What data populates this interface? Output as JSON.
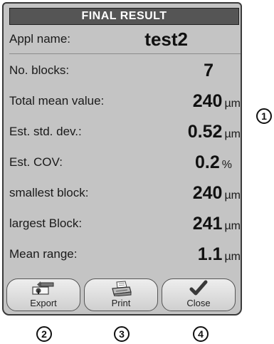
{
  "title": "FINAL RESULT",
  "appl": {
    "label": "Appl name:",
    "value": "test2"
  },
  "rows": [
    {
      "label": "No. blocks:",
      "value": "7",
      "unit": ""
    },
    {
      "label": "Total mean value:",
      "value": "240",
      "unit": "µm"
    },
    {
      "label": "Est. std. dev.:",
      "value": "0.52",
      "unit": "µm"
    },
    {
      "label": "Est. COV:",
      "value": "0.2",
      "unit": "%"
    },
    {
      "label": "smallest block:",
      "value": "240",
      "unit": "µm"
    },
    {
      "label": "largest Block:",
      "value": "241",
      "unit": "µm"
    },
    {
      "label": "Mean range:",
      "value": "1.1",
      "unit": "µm"
    }
  ],
  "buttons": {
    "export": "Export",
    "print": "Print",
    "close": "Close"
  },
  "callouts": {
    "c1": "1",
    "c2": "2",
    "c3": "3",
    "c4": "4"
  },
  "icons": {
    "export": "export-icon",
    "print": "printer-icon",
    "close": "checkmark-icon"
  },
  "colors": {
    "panel": "#c4c4c4",
    "titlebar": "#555555"
  }
}
